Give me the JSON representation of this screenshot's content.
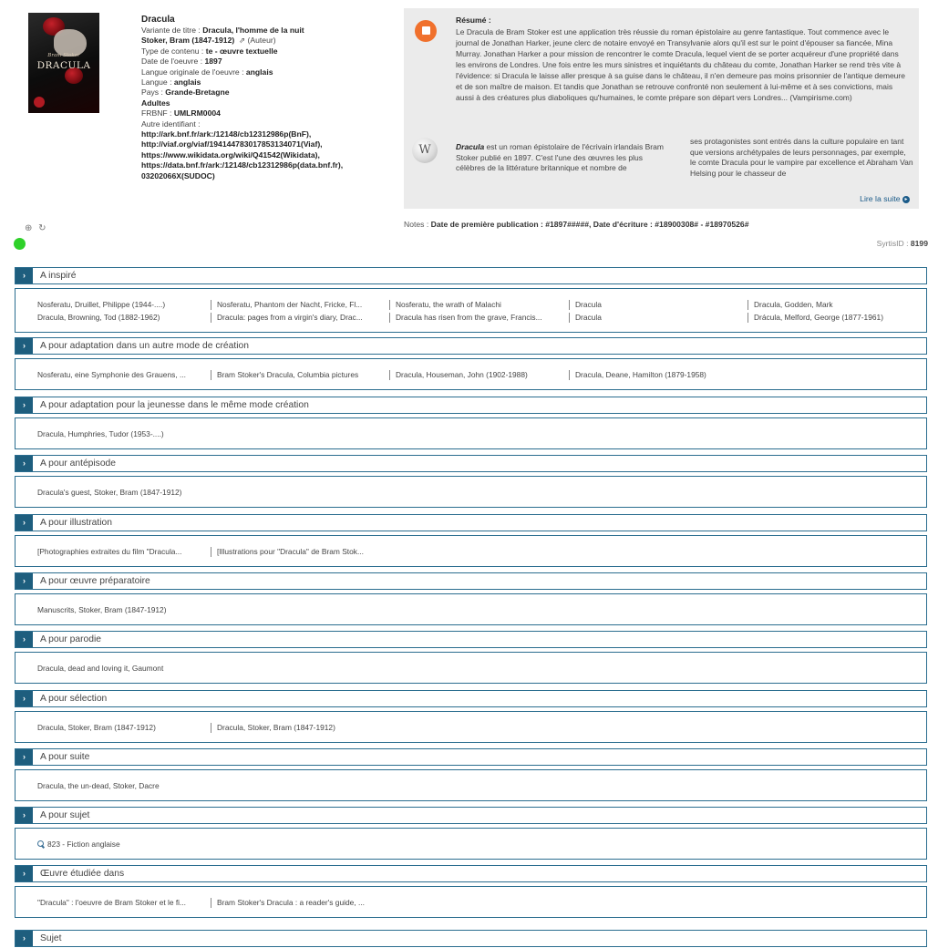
{
  "work": {
    "title": "Dracula",
    "cover_author": "Bram Stoker",
    "cover_title": "DRACULA",
    "variant_label": "Variante de titre : ",
    "variant_value": "Dracula, l'homme de la nuit",
    "author_value": "Stoker, Bram (1847-1912)",
    "author_role": "(Auteur)",
    "content_type_label": "Type de contenu : ",
    "content_type_value": "te - œuvre textuelle",
    "date_label": "Date de l'oeuvre : ",
    "date_value": "1897",
    "orig_lang_label": "Langue originale de l'oeuvre : ",
    "orig_lang_value": "anglais",
    "lang_label": "Langue : ",
    "lang_value": "anglais",
    "country_label": "Pays : ",
    "country_value": "Grande-Bretagne",
    "audience": "Adultes",
    "frbnf_label": "FRBNF : ",
    "frbnf_value": "UMLRM0004",
    "other_id_label": "Autre identifiant :",
    "other_ids": [
      "http://ark.bnf.fr/ark:/12148/cb12312986p(BnF),",
      "http://viaf.org/viaf/194144783017853134071(Viaf),",
      "https://www.wikidata.org/wiki/Q41542(Wikidata),",
      "https://data.bnf.fr/ark:/12148/cb12312986p(data.bnf.fr),",
      "03202066X(SUDOC)"
    ]
  },
  "tools": {
    "icons": [
      "add-circle-icon",
      "refresh-icon"
    ],
    "glyphs": "⊕ ↻"
  },
  "status": {
    "color": "#2fd12a"
  },
  "summary": {
    "heading": "Résumé :",
    "text": "Le Dracula de Bram Stoker est une application très réussie du roman épistolaire au genre fantastique. Tout commence avec le journal de Jonathan Harker, jeune clerc de notaire envoyé en Transylvanie alors qu'il est sur le point d'épouser sa fiancée, Mina Murray. Jonathan Harker a pour mission de rencontrer le comte Dracula, lequel vient de se porter acquéreur d'une propriété dans les environs de Londres. Une fois entre les murs sinistres et inquiétants du château du comte, Jonathan Harker se rend très vite à l'évidence: si Dracula le laisse aller presque à sa guise dans le château, il n'en demeure pas moins prisonnier de l'antique demeure et de son maître de maison. Et tandis que Jonathan se retrouve confronté non seulement à lui-même et à ses convictions, mais aussi à des créatures plus diaboliques qu'humaines, le comte prépare son départ vers Londres... (Vampirisme.com)",
    "wiki_lead": "Dracula",
    "wiki_left": " est un roman épistolaire de l'écrivain irlandais Bram Stoker publié en 1897. C'est l'une des œuvres les plus célèbres de la littérature britannique et nombre de",
    "wiki_right": "ses protagonistes sont entrés dans la culture populaire en tant que versions archétypales de leurs personnages, par exemple, le comte Dracula pour le vampire par excellence et Abraham Van Helsing pour le chasseur de",
    "read_more": "Lire la suite",
    "read_more_glyph": "▸"
  },
  "notes": {
    "label": "Notes : ",
    "value": "Date de première publication : #1897#####,  Date d'écriture : #18900308# - #18970526#"
  },
  "syrtis": {
    "label": "SyrtisID : ",
    "value": "8199"
  },
  "sections": [
    {
      "label": "A inspiré",
      "items": [
        "Nosferatu, Druillet, Philippe (1944-....)",
        "Nosferatu, Phantom der Nacht, Fricke, Fl...",
        "Nosferatu, the wrath of Malachi",
        "Dracula",
        "Dracula, Godden, Mark",
        "Dracula, Browning, Tod (1882-1962)",
        "Dracula: pages from a virgin's diary, Drac...",
        "Dracula has risen from the grave, Francis...",
        "Dracula",
        "Drácula, Melford, George (1877-1961)"
      ]
    },
    {
      "label": "A pour adaptation dans un autre mode de création",
      "items": [
        "Nosferatu, eine Symphonie des Grauens, ...",
        "Bram Stoker's Dracula, Columbia pictures",
        "Dracula, Houseman, John (1902-1988)",
        "Dracula, Deane, Hamilton (1879-1958)"
      ]
    },
    {
      "label": "A pour adaptation pour la jeunesse dans le même mode création",
      "items": [
        "Dracula, Humphries, Tudor (1953-....)"
      ]
    },
    {
      "label": "A pour antépisode",
      "items": [
        "Dracula's guest, Stoker, Bram (1847-1912)"
      ]
    },
    {
      "label": "A pour illustration",
      "items": [
        "[Photographies extraites du film \"Dracula...",
        "[Illustrations pour \"Dracula\" de Bram Stok..."
      ]
    },
    {
      "label": "A pour œuvre préparatoire",
      "items": [
        "Manuscrits, Stoker, Bram (1847-1912)"
      ]
    },
    {
      "label": "A pour parodie",
      "items": [
        "Dracula, dead and loving it, Gaumont"
      ]
    },
    {
      "label": "A pour sélection",
      "items": [
        "Dracula, Stoker, Bram (1847-1912)",
        "Dracula, Stoker, Bram (1847-1912)"
      ]
    },
    {
      "label": "A pour suite",
      "items": [
        "Dracula, the un-dead, Stoker, Dacre"
      ]
    },
    {
      "label": "A pour sujet",
      "items": [
        "823 - Fiction anglaise"
      ]
    },
    {
      "label": "Œuvre étudiée dans",
      "items": [
        "\"Dracula\" : l'oeuvre de Bram Stoker et le fi...",
        "Bram Stoker's Dracula : a reader's guide, ..."
      ]
    },
    {
      "label": "Sujet",
      "items": []
    }
  ],
  "chevron": "›"
}
